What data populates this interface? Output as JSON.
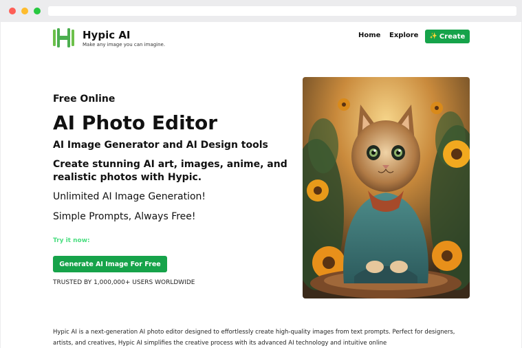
{
  "browser": {
    "controls": [
      "close-icon",
      "minimize-icon",
      "maximize-icon"
    ]
  },
  "brand": {
    "name": "Hypic AI",
    "tagline": "Make any image you can imagine.",
    "logo_icon": "hypic-logo-icon",
    "color": "#4caf50"
  },
  "nav": {
    "home": "Home",
    "explore": "Explore",
    "create": "Create",
    "create_icon": "sparkles-icon"
  },
  "hero": {
    "eyebrow": "Free Online",
    "title": "AI Photo Editor",
    "subtitle": "AI Image Generator and AI Design tools",
    "description": "Create stunning AI art, images, anime, and realistic photos with Hypic.",
    "line1": "Unlimited AI Image Generation!",
    "line2": "Simple Prompts, Always Free!",
    "try_label": "Try it now:",
    "cta": "Generate AI Image For Free",
    "trusted": "TRUSTED BY 1,000,000+ USERS WORLDWIDE"
  },
  "image": {
    "subject": "kitten-sunflowers-image"
  },
  "about": {
    "text": "Hypic AI is a next-generation AI photo editor designed to effortlessly create high-quality images from text prompts. Perfect for designers, artists, and creatives, Hypic AI simplifies the creative process with its advanced AI technology and intuitive online"
  },
  "colors": {
    "accent": "#16a34a",
    "try_label": "#4ade80"
  }
}
